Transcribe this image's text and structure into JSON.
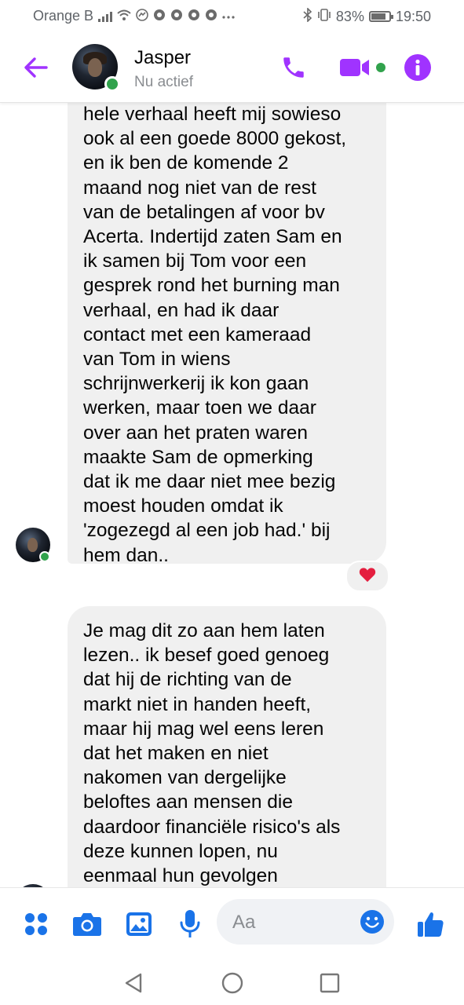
{
  "status_bar": {
    "carrier": "Orange B",
    "battery": "83%",
    "battery_level": 0.83,
    "time": "19:50"
  },
  "header": {
    "contact_name": "Jasper",
    "contact_status": "Nu actief",
    "accent_color": "#a033ff",
    "online_color": "#31a24c"
  },
  "messages": [
    {
      "sender": "Jasper",
      "lines": [
        "hele verhaal heeft mij sowieso",
        "ook al een goede 8000 gekost,",
        "en ik ben de komende 2",
        "maand nog niet van de rest",
        "van de betalingen af voor bv",
        "Acerta. Indertijd zaten Sam en",
        "ik samen bij Tom voor een",
        "gesprek rond het burning man",
        "verhaal, en had ik daar",
        "contact met een kameraad",
        "van Tom in wiens",
        "schrijnwerkerij ik kon gaan",
        "werken, maar toen we daar",
        "over aan het praten waren",
        "maakte Sam de opmerking",
        "dat ik me daar niet mee bezig",
        "moest houden omdat ik",
        "'zogezegd al een job had.' bij",
        "hem dan.."
      ],
      "reaction": "heart"
    },
    {
      "sender": "Jasper",
      "lines": [
        "Je mag dit zo aan hem laten",
        "lezen.. ik besef goed genoeg",
        "dat hij de richting van de",
        "markt niet in handen heeft,",
        "maar hij mag wel eens leren",
        "dat het maken en niet",
        "nakomen van dergelijke",
        "beloftes aan mensen die",
        "daardoor financiële risico's als",
        "deze kunnen lopen, nu",
        "eenmaal hun gevolgen"
      ]
    }
  ],
  "composer": {
    "placeholder": "Aa",
    "icons": [
      "apps-icon",
      "camera-icon",
      "gallery-icon",
      "microphone-icon",
      "emoji-icon",
      "thumbs-up-icon"
    ]
  }
}
